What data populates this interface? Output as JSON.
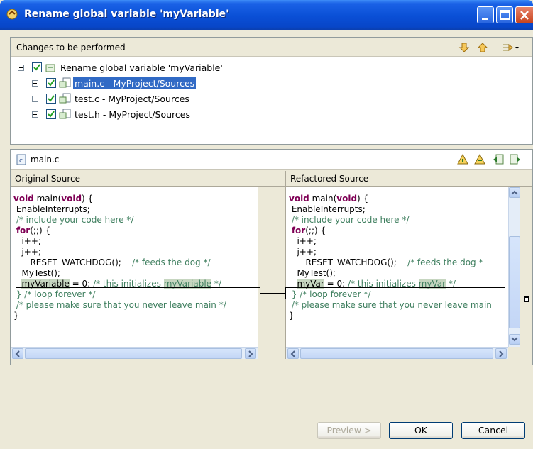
{
  "window": {
    "title": "Rename global variable 'myVariable'"
  },
  "changes": {
    "header": "Changes to be performed",
    "root_label": "Rename global variable 'myVariable'",
    "files": [
      {
        "label": "main.c - MyProject/Sources",
        "selected": true
      },
      {
        "label": "test.c - MyProject/Sources",
        "selected": false
      },
      {
        "label": "test.h - MyProject/Sources",
        "selected": false
      }
    ]
  },
  "compare": {
    "file_name": "main.c",
    "original_header": "Original Source",
    "refactored_header": "Refactored Source"
  },
  "original_lines": [
    "void main(void) {",
    " EnableInterrupts;",
    " /* include your code here */",
    " for(;;) {",
    "   i++;",
    "   j++;",
    "   __RESET_WATCHDOG();    /* feeds the dog */",
    "   MyTest();",
    "   myVariable = 0; /* this initializes myVariable */",
    " } /* loop forever */",
    " /* please make sure that you never leave main */",
    "}"
  ],
  "refactored_lines": [
    "void main(void) {",
    " EnableInterrupts;",
    " /* include your code here */",
    " for(;;) {",
    "   i++;",
    "   j++;",
    "   __RESET_WATCHDOG();    /* feeds the dog *",
    "   MyTest();",
    "   myVar = 0; /* this initializes myVar */",
    " } /* loop forever */",
    " /* please make sure that you never leave main",
    "}"
  ],
  "buttons": {
    "preview": "Preview >",
    "ok": "OK",
    "cancel": "Cancel"
  },
  "colors": {
    "keyword": "#7f0055",
    "comment": "#3f7f5f",
    "selection": "#316ac5",
    "title_bar": "#0a4fd6"
  }
}
